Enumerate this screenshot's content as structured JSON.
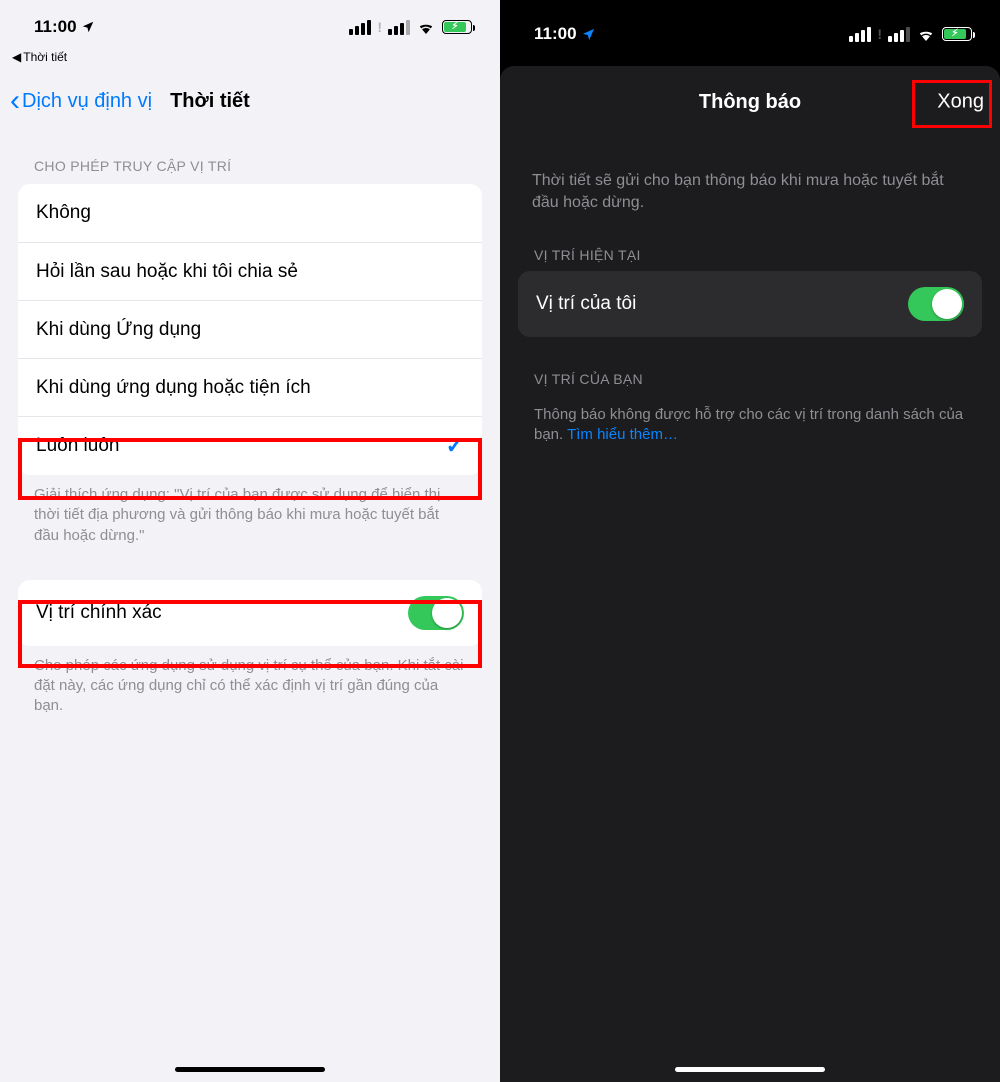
{
  "left": {
    "status_time": "11:00",
    "breadcrumb": "Thời tiết",
    "nav_back": "Dịch vụ định vị",
    "nav_title": "Thời tiết",
    "section_header": "CHO PHÉP TRUY CẬP VỊ TRÍ",
    "options": {
      "o0": "Không",
      "o1": "Hỏi lần sau hoặc khi tôi chia sẻ",
      "o2": "Khi dùng Ứng dụng",
      "o3": "Khi dùng ứng dụng hoặc tiện ích",
      "o4": "Luôn luôn"
    },
    "explain": "Giải thích ứng dụng: \"Vị trí của bạn được sử dụng để hiển thị thời tiết địa phương và gửi thông báo khi mưa hoặc tuyết bắt đầu hoặc dừng.\"",
    "precise_label": "Vị trí chính xác",
    "precise_footer": "Cho phép các ứng dụng sử dụng vị trí cụ thể của bạn. Khi tắt cài đặt này, các ứng dụng chỉ có thể xác định vị trí gần đúng của bạn."
  },
  "right": {
    "status_time": "11:00",
    "modal_title": "Thông báo",
    "done": "Xong",
    "intro": "Thời tiết sẽ gửi cho bạn thông báo khi mưa hoặc tuyết bắt đầu hoặc dừng.",
    "sec1_header": "VỊ TRÍ HIỆN TẠI",
    "my_location": "Vị trí của tôi",
    "sec2_header": "VỊ TRÍ CỦA BẠN",
    "footer_text": "Thông báo không được hỗ trợ cho các vị trí trong danh sách của bạn. ",
    "footer_link": "Tìm hiểu thêm…"
  }
}
